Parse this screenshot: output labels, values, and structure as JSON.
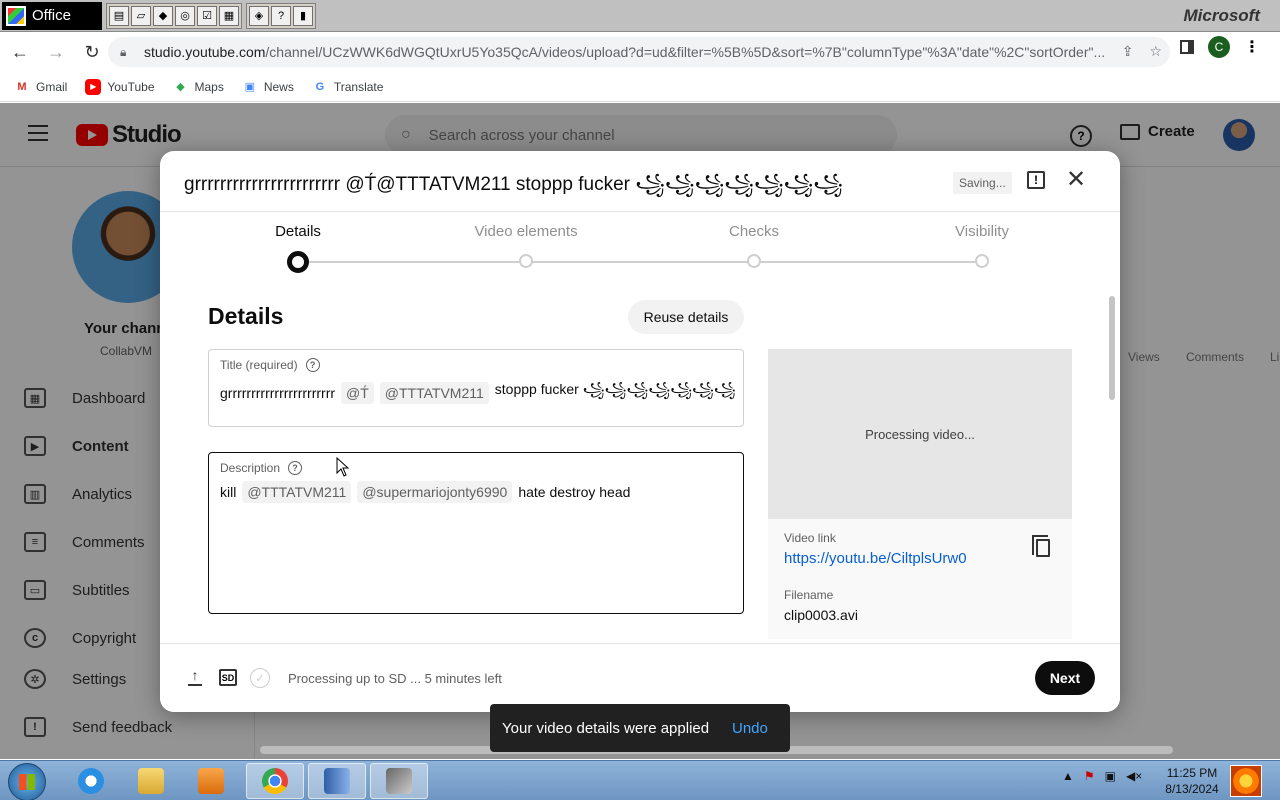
{
  "office": {
    "label": "Office",
    "brand": "Microsoft",
    "icons": [
      "new-doc-icon",
      "open-folder-icon",
      "word-icon",
      "outlook-icon",
      "form-icon",
      "task-icon",
      "excel-icon",
      "help-icon",
      "book-icon"
    ]
  },
  "browser": {
    "url_host": "studio.youtube.com",
    "url_rest": "/channel/UCzWWK6dWGQtUxrU5Yo35QcA/videos/upload?d=ud&filter=%5B%5D&sort=%7B\"columnType\"%3A\"date\"%2C\"sortOrder\"...",
    "profile_initial": "C",
    "bookmarks": [
      "Gmail",
      "YouTube",
      "Maps",
      "News",
      "Translate"
    ]
  },
  "studio": {
    "logo_text": "Studio",
    "search_placeholder": "Search across your channel",
    "create_label": "Create",
    "channel_name": "Your chann",
    "channel_sub": "CollabVM",
    "nav": [
      "Dashboard",
      "Content",
      "Analytics",
      "Comments",
      "Subtitles",
      "Copyright",
      "Settings",
      "Send feedback"
    ],
    "bg_columns": [
      "Views",
      "Comments",
      "Li"
    ]
  },
  "modal": {
    "title": "grrrrrrrrrrrrrrrrrrrrrrr @T́@TTTATVM211 stoppp fucker ꧁꧁꧁꧁꧁꧁꧁",
    "saving": "Saving...",
    "steps": [
      "Details",
      "Video elements",
      "Checks",
      "Visibility"
    ],
    "heading": "Details",
    "reuse_label": "Reuse details",
    "title_field": {
      "label": "Title (required)",
      "text1": "grrrrrrrrrrrrrrrrrrrrrrr",
      "chip1": "@T́",
      "chip2": "@TTTATVM211",
      "text2": "stoppp fucker ꧁꧁꧁꧁꧁꧁꧁"
    },
    "desc_field": {
      "label": "Description",
      "text1": "kill",
      "chip1": "@TTTATVM211",
      "chip2": "@supermariojonty6990",
      "text2": "hate destroy head"
    },
    "preview": {
      "processing": "Processing video...",
      "link_label": "Video link",
      "link": "https://youtu.be/CiltplsUrw0",
      "filename_label": "Filename",
      "filename": "clip0003.avi"
    },
    "footer_status": "Processing up to SD ... 5 minutes left",
    "sd_badge": "SD",
    "next_label": "Next"
  },
  "toast": {
    "message": "Your video details were applied",
    "undo": "Undo"
  },
  "taskbar": {
    "time": "11:25 PM",
    "date": "8/13/2024"
  }
}
